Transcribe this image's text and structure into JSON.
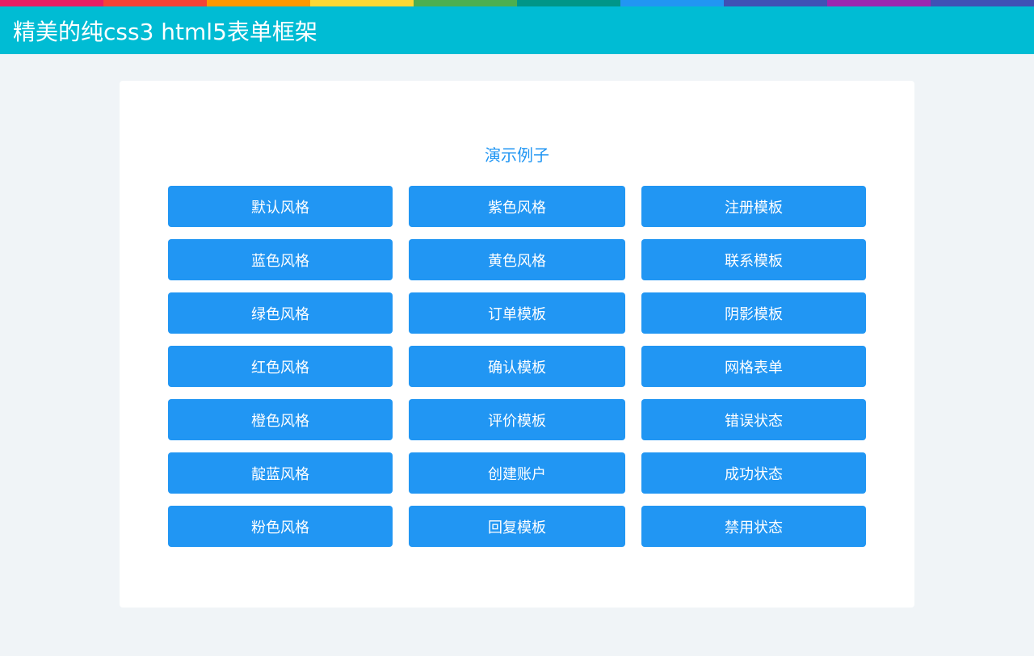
{
  "strip_colors": [
    "#e91e63",
    "#f44336",
    "#ff9800",
    "#fdd835",
    "#4caf50",
    "#009688",
    "#2196f3",
    "#3f51b5",
    "#9c27b0",
    "#3f51b5"
  ],
  "header": {
    "title": "精美的纯css3 html5表单框架",
    "background": "#00bcd4"
  },
  "section": {
    "title": "演示例子"
  },
  "accent": "#2196f3",
  "buttons": [
    "默认风格",
    "紫色风格",
    "注册模板",
    "蓝色风格",
    "黄色风格",
    "联系模板",
    "绿色风格",
    "订单模板",
    "阴影模板",
    "红色风格",
    "确认模板",
    "网格表单",
    "橙色风格",
    "评价模板",
    "错误状态",
    "靛蓝风格",
    "创建账户",
    "成功状态",
    "粉色风格",
    "回复模板",
    "禁用状态"
  ]
}
